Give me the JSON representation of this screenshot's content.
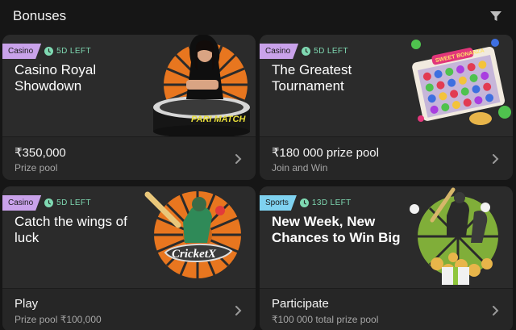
{
  "header": {
    "title": "Bonuses"
  },
  "colors": {
    "background": "#161616",
    "card": "#262626",
    "casino_tag": "#c9a2ea",
    "sports_tag": "#7fd2f0",
    "timer": "#7fd9b2"
  },
  "icons": {
    "filter": "filter-icon",
    "clock": "clock-icon",
    "chevron": "chevron-right-icon"
  },
  "cards": [
    {
      "tag": "Casino",
      "time_left": "5D LEFT",
      "title": "Casino Royal Showdown",
      "main_text": "₹350,000",
      "sub_text": "Prize pool",
      "art_logo": "PARI MATCH"
    },
    {
      "tag": "Casino",
      "time_left": "5D LEFT",
      "title": "The Greatest Tournament",
      "main_text": "₹180 000 prize pool",
      "sub_text": "Join and Win",
      "art_logo": "SWEET BONANZA"
    },
    {
      "tag": "Casino",
      "time_left": "5D LEFT",
      "title": "Catch the wings of luck",
      "main_text": "Play",
      "sub_text": "Prize pool ₹100,000",
      "art_logo": "CricketX"
    },
    {
      "tag": "Sports",
      "time_left": "13D LEFT",
      "title": "New Week, New Chances to Win Big",
      "main_text": "Participate",
      "sub_text": "₹100 000 total prize pool",
      "art_logo": ""
    }
  ]
}
